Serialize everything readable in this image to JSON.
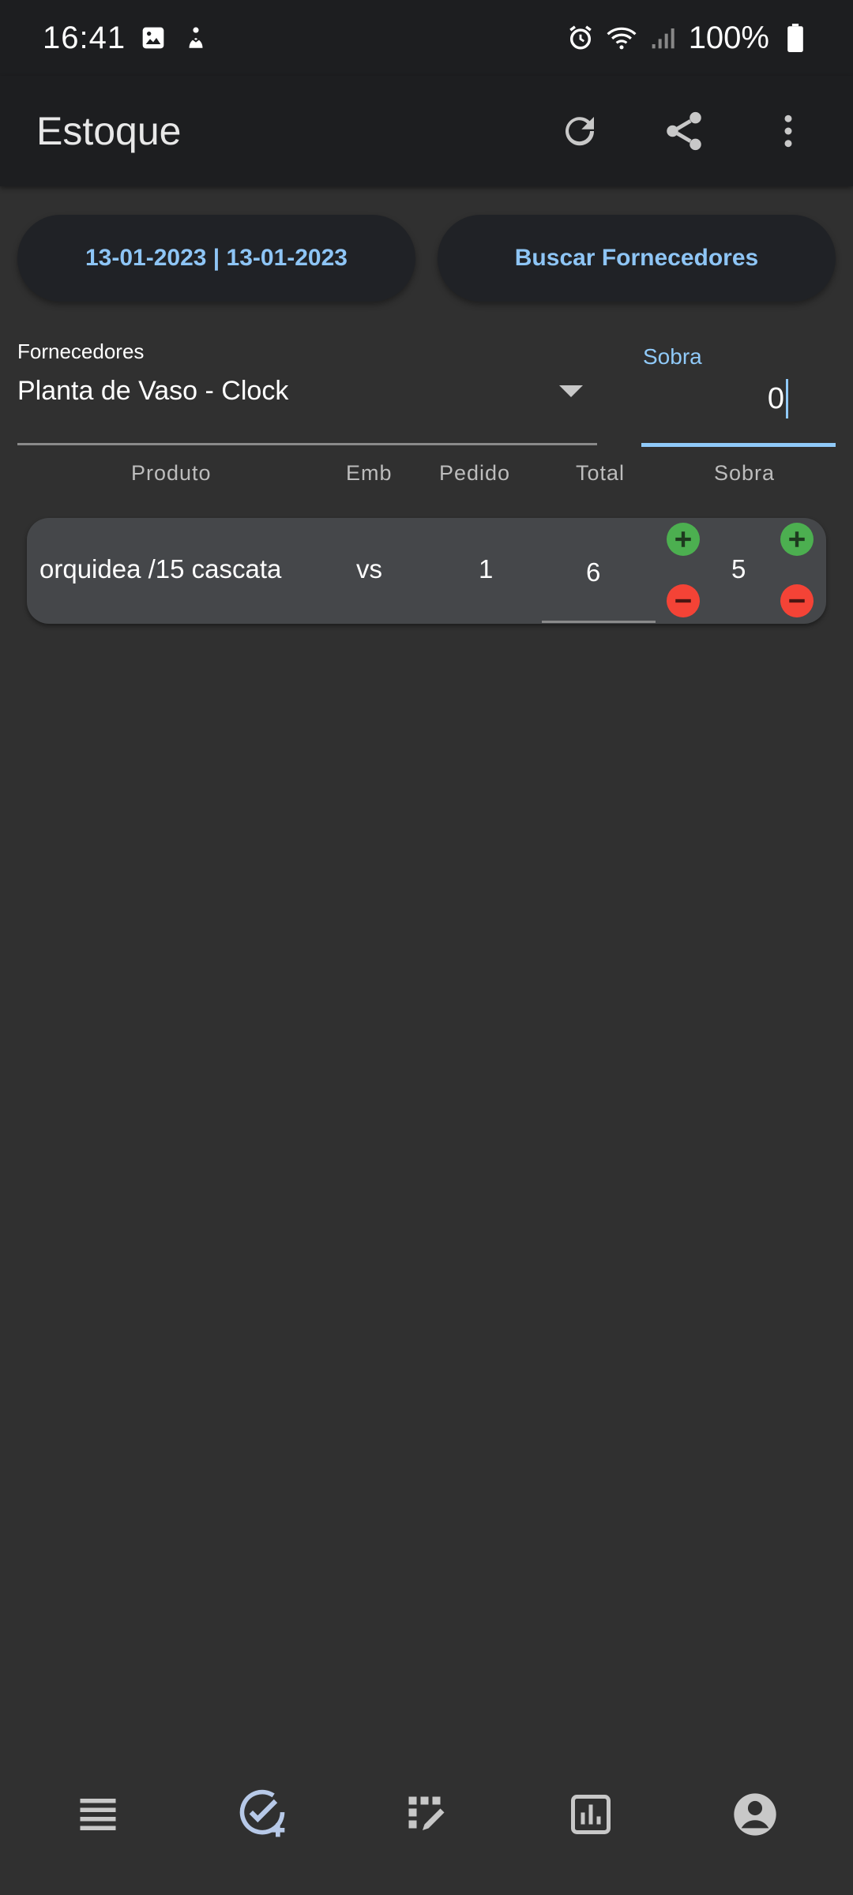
{
  "status_bar": {
    "time": "16:41",
    "battery": "100%",
    "icons": [
      "image-icon",
      "accessibility-icon",
      "alarm-icon",
      "wifi-icon",
      "signal-icon",
      "battery-icon"
    ]
  },
  "app_bar": {
    "title": "Estoque",
    "actions": [
      "refresh-icon",
      "share-icon",
      "more-vert-icon"
    ]
  },
  "filters": {
    "date_range_label": "13-01-2023 | 13-01-2023",
    "search_suppliers_label": "Buscar Fornecedores"
  },
  "supplier_dropdown": {
    "label": "Fornecedores",
    "value": "Planta de Vaso - Clock"
  },
  "sobra_input": {
    "label": "Sobra",
    "value": "0"
  },
  "table": {
    "headers": [
      "Produto",
      "Emb",
      "Pedido",
      "Total",
      "Sobra"
    ],
    "rows": [
      {
        "produto": "orquidea /15 cascata",
        "emb": "vs",
        "pedido": "1",
        "total": "6",
        "sobra": "5"
      }
    ]
  },
  "bottom_nav": [
    "list-icon",
    "add-task-icon",
    "inventory-edit-icon",
    "report-chart-icon",
    "account-circle-icon"
  ],
  "colors": {
    "accent": "#90caf9",
    "plus": "#4caf50",
    "minus": "#f44336",
    "background": "#303030",
    "app_bar": "#1d1e20"
  }
}
